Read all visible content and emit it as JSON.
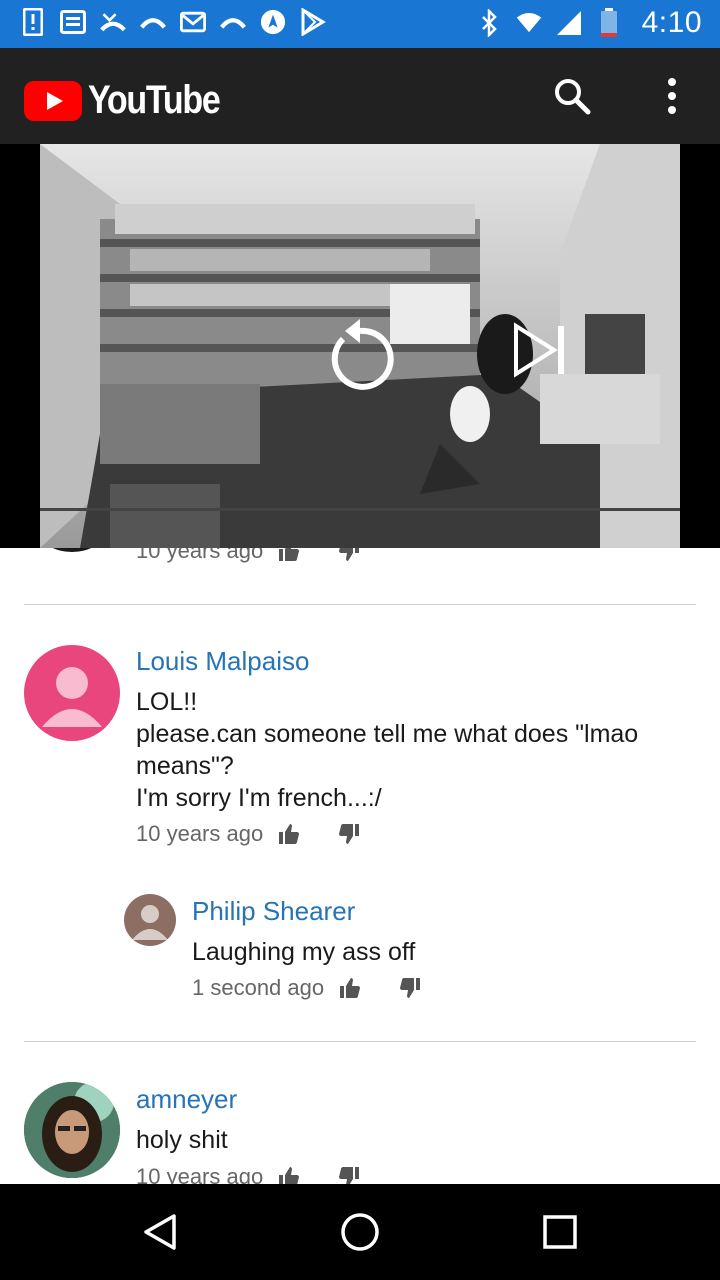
{
  "status_bar": {
    "time": "4:10",
    "left_icons": [
      "alert-icon",
      "notes-icon",
      "missed-call-icon",
      "call-icon",
      "mail-icon",
      "call-icon",
      "navigation-icon",
      "play-store-icon"
    ],
    "right_icons": [
      "bluetooth-icon",
      "wifi-icon",
      "signal-icon",
      "battery-icon"
    ]
  },
  "app_bar": {
    "brand": "YouTube",
    "brand_color": "#ff0000",
    "actions": [
      "search-icon",
      "more-vert-icon"
    ]
  },
  "player": {
    "controls": [
      "replay-icon",
      "skip-next-icon"
    ]
  },
  "comments": {
    "partial_top": {
      "time": "10 years ago"
    },
    "items": [
      {
        "author": "Louis Malpaiso",
        "text": "LOL!!\nplease.can someone tell me what does \"lmao means\"?\nI'm sorry I'm french...:/",
        "time": "10 years ago",
        "avatar_color": "#e8467c",
        "reply": {
          "author": "Philip Shearer",
          "text": "Laughing my ass off",
          "time": "1 second ago",
          "avatar_color": "#8d6e63"
        }
      },
      {
        "author": "amneyer",
        "text": "holy shit",
        "time": "10 years ago"
      }
    ]
  },
  "nav_bar": {
    "buttons": [
      "back-icon",
      "home-icon",
      "recents-icon"
    ]
  }
}
